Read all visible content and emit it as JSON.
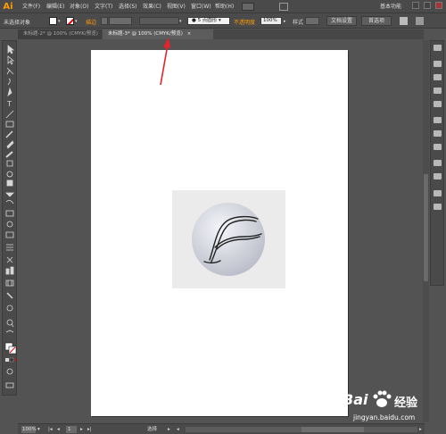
{
  "app": {
    "logo": "Ai",
    "workspace_label": "基本功能"
  },
  "menubar": {
    "items": [
      "文件(F)",
      "编辑(E)",
      "对象(O)",
      "文字(T)",
      "选择(S)",
      "效果(C)",
      "视图(V)",
      "窗口(W)",
      "帮助(H)"
    ]
  },
  "control_bar": {
    "selection_status": "未选择对象",
    "stroke_label": "描边",
    "brush_value": "5 点圆形",
    "opacity_label": "不透明度",
    "opacity_value": "100%",
    "style_label": "样式",
    "doc_setup_button": "文档设置",
    "preferences_button": "首选项"
  },
  "tabs": [
    {
      "label": "未标题-2* @ 100% (CMYK/预览)",
      "active": false
    },
    {
      "label": "未标题-3* @ 100% (CMYK/预览)",
      "active": true
    }
  ],
  "statusbar": {
    "zoom": "100%",
    "page": "1",
    "tool_label": "选择"
  },
  "watermark": {
    "brand": "Bai",
    "product": "经验",
    "url": "jingyan.baidu.com"
  },
  "colors": {
    "accent": "#ff9a00",
    "annotation_arrow": "#e8222a"
  }
}
